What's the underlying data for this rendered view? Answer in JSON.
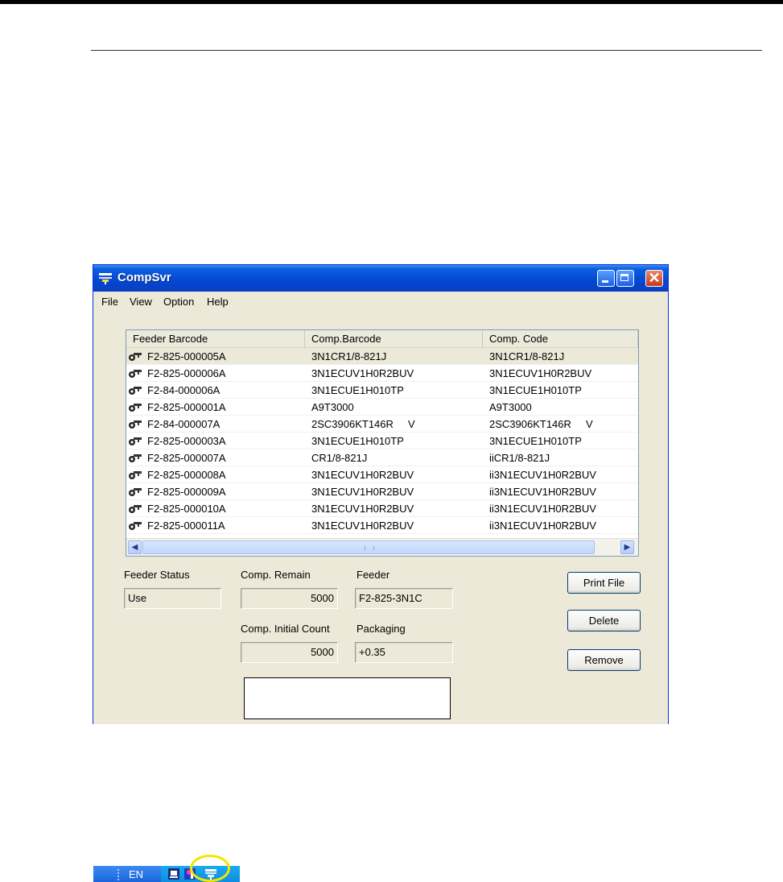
{
  "window": {
    "title": "CompSvr",
    "menu": [
      "File",
      "View",
      "Option",
      "Help"
    ]
  },
  "list": {
    "columns": [
      "Feeder Barcode",
      "Comp.Barcode",
      "Comp. Code"
    ],
    "rows": [
      [
        "F2-825-000005A",
        "3N1CR1/8-821J",
        "3N1CR1/8-821J"
      ],
      [
        "F2-825-000006A",
        "3N1ECUV1H0R2BUV",
        "3N1ECUV1H0R2BUV"
      ],
      [
        "F2-84-000006A",
        "3N1ECUE1H010TP",
        "3N1ECUE1H010TP"
      ],
      [
        "F2-825-000001A",
        "A9T3000",
        "A9T3000"
      ],
      [
        "F2-84-000007A",
        "2SC3906KT146R     V",
        "2SC3906KT146R     V"
      ],
      [
        "F2-825-000003A",
        "3N1ECUE1H010TP",
        "3N1ECUE1H010TP"
      ],
      [
        "F2-825-000007A",
        "CR1/8-821J",
        "iiCR1/8-821J"
      ],
      [
        "F2-825-000008A",
        "3N1ECUV1H0R2BUV",
        "ii3N1ECUV1H0R2BUV"
      ],
      [
        "F2-825-000009A",
        "3N1ECUV1H0R2BUV",
        "ii3N1ECUV1H0R2BUV"
      ],
      [
        "F2-825-000010A",
        "3N1ECUV1H0R2BUV",
        "ii3N1ECUV1H0R2BUV"
      ],
      [
        "F2-825-000011A",
        "3N1ECUV1H0R2BUV",
        "ii3N1ECUV1H0R2BUV"
      ]
    ]
  },
  "fields": {
    "feeder_status_label": "Feeder Status",
    "feeder_status_value": "Use",
    "comp_remain_label": "Comp. Remain",
    "comp_remain_value": "5000",
    "feeder_label": "Feeder",
    "feeder_value": "F2-825-3N1C",
    "initial_count_label": "Comp. Initial Count",
    "initial_count_value": "5000",
    "packaging_label": "Packaging",
    "packaging_value": "+0.35"
  },
  "buttons": {
    "print_file": "Print File",
    "delete": "Delete",
    "remove": "Remove"
  },
  "taskbar": {
    "language": "EN"
  },
  "colors": {
    "titlebar": "#0546d1",
    "window_bg": "#ece9d8",
    "tray_highlight": "#f3e600"
  }
}
